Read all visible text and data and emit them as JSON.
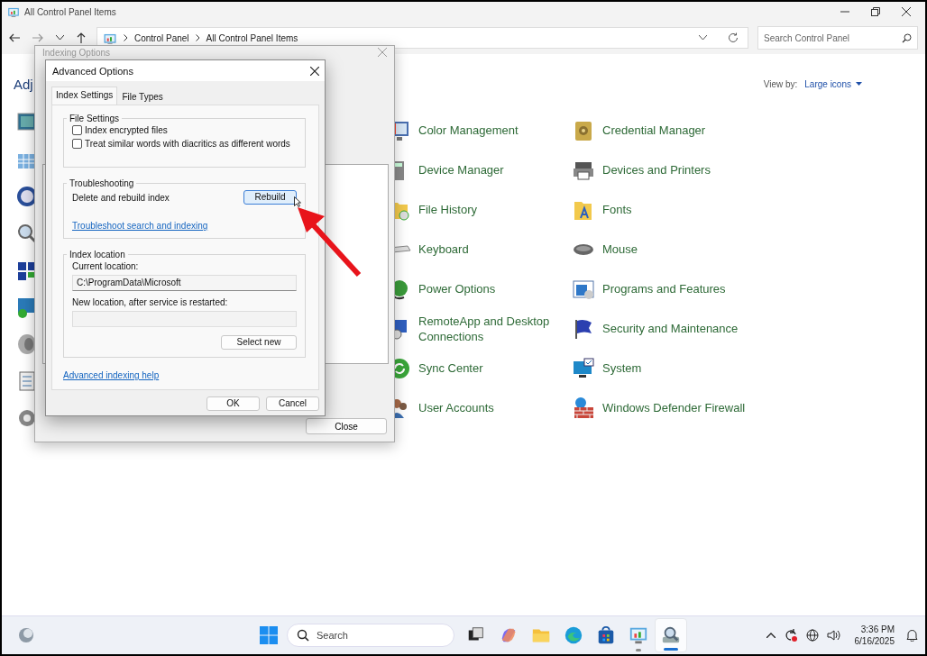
{
  "window": {
    "title": "All Control Panel Items"
  },
  "address_bar": {
    "crumbs": [
      "Control Panel",
      "All Control Panel Items"
    ]
  },
  "search": {
    "placeholder": "Search Control Panel"
  },
  "heading": "Adj",
  "view_by": {
    "label": "View by:",
    "value": "Large icons"
  },
  "items": [
    {
      "label": "Color Management"
    },
    {
      "label": "Credential Manager"
    },
    {
      "label": "Device Manager"
    },
    {
      "label": "Devices and Printers"
    },
    {
      "label": "File History"
    },
    {
      "label": "Fonts"
    },
    {
      "label": "Keyboard"
    },
    {
      "label": "Mouse"
    },
    {
      "label": "Power Options"
    },
    {
      "label": "Programs and Features"
    },
    {
      "label": "RemoteApp and Desktop Connections"
    },
    {
      "label": "Security and Maintenance"
    },
    {
      "label": "Sync Center"
    },
    {
      "label": "System"
    },
    {
      "label": "User Accounts"
    },
    {
      "label": "Windows Defender Firewall"
    }
  ],
  "indexing_options": {
    "title": "Indexing Options",
    "close_button": "Close"
  },
  "advanced_options": {
    "title": "Advanced Options",
    "tabs": [
      {
        "label": "Index Settings",
        "selected": true
      },
      {
        "label": "File Types",
        "selected": false
      }
    ],
    "file_settings": {
      "legend": "File Settings",
      "options": [
        {
          "label": "Index encrypted files",
          "checked": false
        },
        {
          "label": "Treat similar words with diacritics as different words",
          "checked": false
        }
      ]
    },
    "troubleshooting": {
      "legend": "Troubleshooting",
      "text": "Delete and rebuild index",
      "button": "Rebuild",
      "link": "Troubleshoot search and indexing"
    },
    "index_location": {
      "legend": "Index location",
      "current_label": "Current location:",
      "current_value": "C:\\ProgramData\\Microsoft",
      "new_label": "New location, after service is restarted:",
      "button": "Select new"
    },
    "help_link": "Advanced indexing help",
    "buttons": [
      "OK",
      "Cancel"
    ]
  },
  "taskbar": {
    "search_placeholder": "Search",
    "apps": [
      {
        "kind": "taskview",
        "running": false,
        "selected": false
      },
      {
        "kind": "copilot",
        "running": false,
        "selected": false
      },
      {
        "kind": "explorer",
        "running": false,
        "selected": false
      },
      {
        "kind": "browser",
        "running": false,
        "selected": false
      },
      {
        "kind": "store",
        "running": false,
        "selected": false
      },
      {
        "kind": "controlpanel",
        "running": true,
        "selected": false
      },
      {
        "kind": "indexing",
        "running": true,
        "selected": true
      }
    ],
    "time": "3:36 PM",
    "date": "6/16/2025"
  }
}
